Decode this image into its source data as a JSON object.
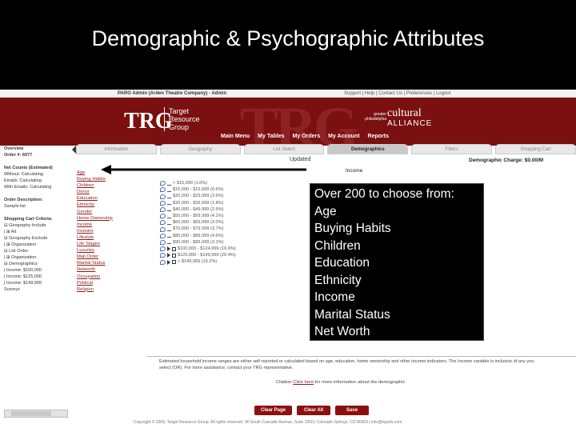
{
  "slide": {
    "title": "Demographic & Psychographic Attributes"
  },
  "topbar": {
    "user": "PARO Admin (Arden Theatre Company) - Admin",
    "links": "Support | Help | Contact Us | Preferences | Logout"
  },
  "header": {
    "logo_mark": "TRG",
    "logo_lines": [
      "Target",
      "Resource",
      "Group"
    ],
    "alliance_small": [
      "greater",
      "philadelphia"
    ],
    "alliance_top": "cultural",
    "alliance_bottom": "ALLIANCE",
    "watermark": "TRG",
    "nav": [
      "Main Menu",
      "My Tables",
      "My Orders",
      "My Account",
      "Reports"
    ]
  },
  "sidebar": {
    "lines": [
      {
        "t": "Overview",
        "b": true
      },
      {
        "t": "Order #: 6077",
        "b": true
      },
      {
        "t": "",
        "b": false
      },
      {
        "t": "Net Counts (Estimated)",
        "b": true
      },
      {
        "t": "Without:      Calculating",
        "b": false
      },
      {
        "t": "Emails:       Calculating",
        "b": false
      },
      {
        "t": "With Emails:  Calculating",
        "b": false
      },
      {
        "t": "",
        "b": false
      },
      {
        "t": "Order Description:",
        "b": true
      },
      {
        "t": "Sample list",
        "b": false
      },
      {
        "t": "",
        "b": false
      },
      {
        "t": "Shopping Cart Criteria:",
        "b": true
      },
      {
        "t": "⊟ Geography Include",
        "b": false
      },
      {
        "t": "  |  ⊞ All",
        "b": false
      },
      {
        "t": "⊟ Geography Exclude",
        "b": false
      },
      {
        "t": "  |  ⊞ Organization",
        "b": false
      },
      {
        "t": "⊟ List Order",
        "b": false
      },
      {
        "t": "  |  ⊞ Organization",
        "b": false
      },
      {
        "t": "⊟ Demographics",
        "b": false
      },
      {
        "t": "  |  Income: $100,000",
        "b": false
      },
      {
        "t": "  |  Income: $125,000",
        "b": false
      },
      {
        "t": "  |  Income: $149,999",
        "b": false
      },
      {
        "t": "Surveys",
        "b": false
      }
    ]
  },
  "tabs": [
    {
      "label": "Information",
      "active": false
    },
    {
      "label": "Geography",
      "active": false
    },
    {
      "label": "List Select",
      "active": false
    },
    {
      "label": "Demographics",
      "active": true
    },
    {
      "label": "Filters",
      "active": false
    },
    {
      "label": "Shopping Cart",
      "active": false
    }
  ],
  "updated": "Updated",
  "demographic_charge": "Demographic Charge: $0.00/M",
  "income_label": "Income",
  "categories": [
    "Age",
    "Buying Habits",
    "Children",
    "Donor",
    "Education",
    "Ethnicity",
    "Gender",
    "Home Ownership",
    "Income",
    "Investor",
    "Lifestyle",
    "Life Stages",
    "Luxuries",
    "Mail Order",
    "Marital Status",
    "Networth",
    "Occupation",
    "Political",
    "Religion"
  ],
  "income_options": [
    {
      "label": "< $15,000 (1.0%)",
      "sel": false
    },
    {
      "label": "$15,000 - $19,999 (0.6%)",
      "sel": false
    },
    {
      "label": "$20,000 - $29,999 (3.6%)",
      "sel": false
    },
    {
      "label": "$30,000 - $39,999 (1.8%)",
      "sel": false
    },
    {
      "label": "$40,000 - $49,999 (2.5%)",
      "sel": false
    },
    {
      "label": "$50,000 - $59,999 (4.1%)",
      "sel": false
    },
    {
      "label": "$60,000 - $69,999 (3.0%)",
      "sel": false
    },
    {
      "label": "$70,000 - $79,999 (3.7%)",
      "sel": false
    },
    {
      "label": "$80,000 - $89,999 (4.6%)",
      "sel": false
    },
    {
      "label": "$90,000 - $99,999 (3.1%)",
      "sel": false
    },
    {
      "label": "$100,000 - $124,999 (16.6%)",
      "sel": true
    },
    {
      "label": "$125,000 - $149,999 (20.4%)",
      "sel": true
    },
    {
      "label": "> $149,999 (19.2%)",
      "sel": true
    }
  ],
  "callout": {
    "lines": [
      "Over 200 to choose from:",
      "Age",
      "Buying Habits",
      "Children",
      "Education",
      "Ethnicity",
      "Income",
      "Marital Status",
      "Net Worth"
    ]
  },
  "note": "Estimated household income ranges are either self reported or calculated based on age, education, home ownership and other income indicators. The Income variable is inclusive of any you select (OR). For more assistance, contact your TRG representative.",
  "citation": {
    "prefix": "Citation",
    "link": "Click here",
    "suffix": "for more information about the demographic"
  },
  "buttons": [
    "Clear Page",
    "Clear All",
    "Save"
  ],
  "copyright": "Copyright © 2009, Target Resource Group. All rights reserved. 90 South Cascade Avenue, Suite 1050 | Colorado Springs, CO 80903 | info@trgarts.com"
}
